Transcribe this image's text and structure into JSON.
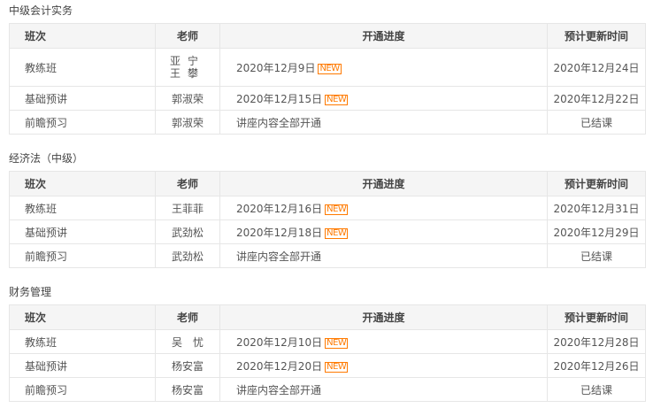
{
  "headers": {
    "cls": "班次",
    "teacher": "老师",
    "progress": "开通进度",
    "update": "预计更新时间"
  },
  "badge": "NEW",
  "sections": [
    {
      "title": "中级会计实务",
      "rows": [
        {
          "cls": "教练班",
          "teachers": [
            "亚宁",
            "王攀"
          ],
          "progress": "2020年12月9日",
          "new": true,
          "update": "2020年12月24日"
        },
        {
          "cls": "基础预讲",
          "teachers": [
            "郭淑荣"
          ],
          "progress": "2020年12月15日",
          "new": true,
          "update": "2020年12月22日"
        },
        {
          "cls": "前瞻预习",
          "teachers": [
            "郭淑荣"
          ],
          "progress": "讲座内容全部开通",
          "new": false,
          "update": "已结课"
        }
      ]
    },
    {
      "title": "经济法（中级）",
      "rows": [
        {
          "cls": "教练班",
          "teachers": [
            "王菲菲"
          ],
          "progress": "2020年12月16日",
          "new": true,
          "update": "2020年12月31日"
        },
        {
          "cls": "基础预讲",
          "teachers": [
            "武劲松"
          ],
          "progress": "2020年12月18日",
          "new": true,
          "update": "2020年12月29日"
        },
        {
          "cls": "前瞻预习",
          "teachers": [
            "武劲松"
          ],
          "progress": "讲座内容全部开通",
          "new": false,
          "update": "已结课"
        }
      ]
    },
    {
      "title": "财务管理",
      "rows": [
        {
          "cls": "教练班",
          "teachers": [
            "吴　忧"
          ],
          "progress": "2020年12月10日",
          "new": true,
          "update": "2020年12月28日"
        },
        {
          "cls": "基础预讲",
          "teachers": [
            "杨安富"
          ],
          "progress": "2020年12月20日",
          "new": true,
          "update": "2020年12月26日"
        },
        {
          "cls": "前瞻预习",
          "teachers": [
            "杨安富"
          ],
          "progress": "讲座内容全部开通",
          "new": false,
          "update": "已结课"
        }
      ]
    }
  ]
}
